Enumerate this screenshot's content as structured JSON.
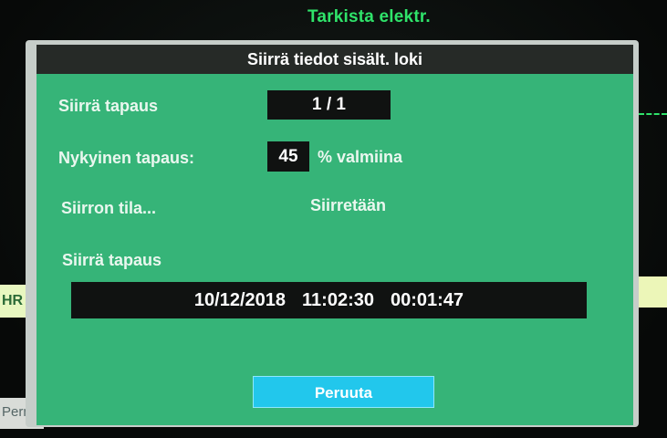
{
  "background": {
    "alarm_text": "Tarkista elektr.",
    "hr_label": "HR",
    "corner_text": "Pern"
  },
  "dialog": {
    "title": "Siirrä tiedot sisält. loki",
    "transfer_event_label": "Siirrä tapaus",
    "transfer_event_value": "1 / 1",
    "current_event_label": "Nykyinen tapaus:",
    "progress_percent": 45,
    "progress_text": "45",
    "progress_suffix": "% valmiina",
    "status_label": "Siirron tila...",
    "status_value": "Siirretään",
    "event_section_label": "Siirrä tapaus",
    "event": {
      "date": "10/12/2018",
      "time": "11:02:30",
      "duration": "00:01:47"
    },
    "cancel_label": "Peruuta"
  },
  "colors": {
    "dialog_background": "#36b478",
    "title_bar": "#262a27",
    "cancel_button": "#22c7ec",
    "alarm_text": "#2fe36a"
  }
}
